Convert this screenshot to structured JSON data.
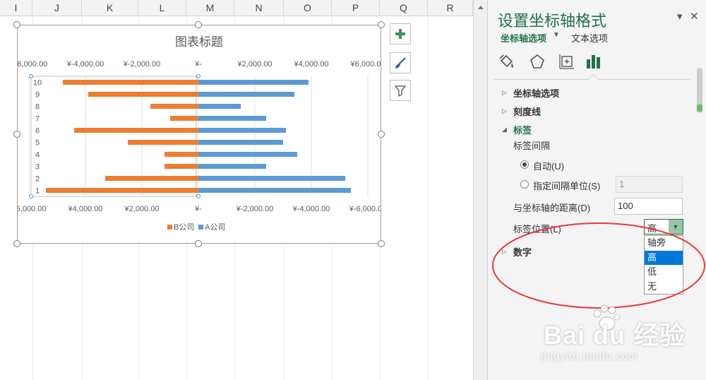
{
  "sheet": {
    "column_headers": [
      "I",
      "J",
      "K",
      "L",
      "M",
      "N",
      "O",
      "P",
      "Q",
      "R"
    ]
  },
  "chart_buttons": {
    "add_icon": "plus-icon",
    "style_icon": "brush-icon",
    "filter_icon": "filter-icon"
  },
  "chart_data": {
    "type": "bar",
    "title": "图表标题",
    "orientation": "horizontal",
    "categories": [
      "1",
      "2",
      "3",
      "4",
      "5",
      "6",
      "7",
      "8",
      "9",
      "10"
    ],
    "series": [
      {
        "name": "B公司",
        "color": "#ed7d31",
        "values": [
          5400,
          3300,
          1200,
          1200,
          2500,
          4400,
          1000,
          1700,
          3900,
          4800
        ]
      },
      {
        "name": "A公司",
        "color": "#5b9bd5",
        "values": [
          5400,
          5200,
          2400,
          3500,
          3000,
          3100,
          2400,
          1500,
          3400,
          3900
        ]
      }
    ],
    "top_axis_ticks": [
      "¥-6,000.00",
      "¥-4,000.00",
      "¥-2,000.00",
      "¥-",
      "¥2,000.00",
      "¥4,000.00",
      "¥6,000.00"
    ],
    "bottom_axis_ticks": [
      "¥6,000.00",
      "¥4,000.00",
      "¥2,000.00",
      "¥-",
      "¥-2,000.00",
      "¥-4,000.00",
      "¥-6,000.00"
    ],
    "xlim": [
      -6000,
      6000
    ],
    "legend_position": "bottom",
    "grid": true
  },
  "pane": {
    "title": "设置坐标轴格式",
    "tab_axis_options": "坐标轴选项",
    "tab_text_options": "文本选项",
    "icons": [
      "fill-line-icon",
      "effects-icon",
      "size-properties-icon",
      "axis-options-icon"
    ],
    "sections": {
      "axis_options": "坐标轴选项",
      "tick_marks": "刻度线",
      "labels": "标签",
      "number": "数字"
    },
    "label_interval_heading": "标签间隔",
    "radio_auto": "自动(U)",
    "radio_specify": "指定间隔单位(S)",
    "interval_value": "1",
    "distance_label": "与坐标轴的距离(D)",
    "distance_value": "100",
    "position_label": "标签位置(L)",
    "position_selected": "高",
    "position_options": [
      "轴旁",
      "高",
      "低",
      "无"
    ]
  },
  "watermark": {
    "main": "Bai du 经验",
    "url": "jingyan.baidu.com"
  }
}
